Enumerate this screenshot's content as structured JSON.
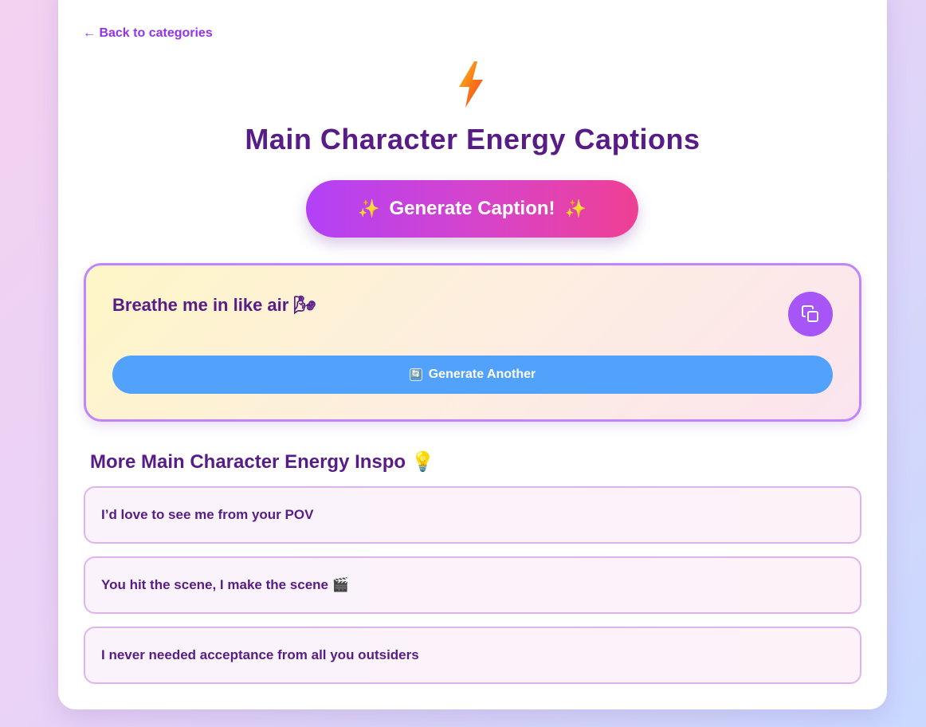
{
  "nav": {
    "back_label": "← Back to categories"
  },
  "header": {
    "icon": "lightning-bolt-icon",
    "title": "Main Character Energy Captions"
  },
  "generate_button": {
    "sparkle": "✨",
    "label": "Generate Caption!"
  },
  "caption": {
    "text": "Breathe me in like air 🌬",
    "copy_icon": "copy-icon",
    "another_icon": "🔄",
    "another_label": "Generate Another"
  },
  "inspo": {
    "title": "More Main Character Energy Inspo 💡",
    "items": [
      "I’d love to see me from your POV",
      "You hit the scene, I make the scene 🎬",
      "I never needed acceptance from all you outsiders"
    ]
  },
  "colors": {
    "title": "#581c87",
    "accent": "#9333ea",
    "copy_button": "#a855f7",
    "another_button": "#52a2fb",
    "caption_border": "#c084fc"
  }
}
